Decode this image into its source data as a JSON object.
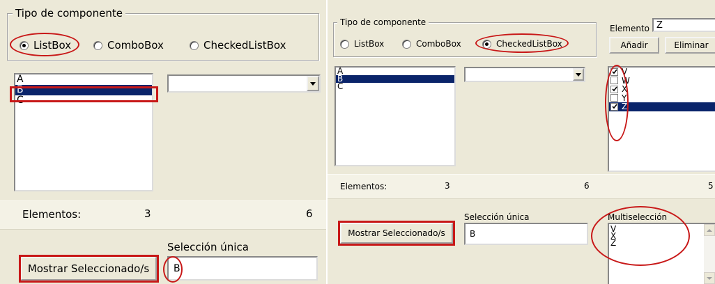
{
  "left": {
    "group_title": "Tipo de componente",
    "radios": [
      {
        "label": "ListBox",
        "checked": true
      },
      {
        "label": "ComboBox",
        "checked": false
      },
      {
        "label": "CheckedListBox",
        "checked": false
      }
    ],
    "listbox_items": [
      {
        "text": "A",
        "selected": false
      },
      {
        "text": "B",
        "selected": true
      },
      {
        "text": "C",
        "selected": false
      }
    ],
    "combo_value": "",
    "elementos_label": "Elementos:",
    "elementos_count_1": "3",
    "elementos_count_2": "6",
    "show_button": "Mostrar Seleccionado/s",
    "seleccion_label": "Selección única",
    "seleccion_value": "B"
  },
  "right": {
    "group_title": "Tipo de componente",
    "radios": [
      {
        "label": "ListBox",
        "checked": false
      },
      {
        "label": "ComboBox",
        "checked": false
      },
      {
        "label": "CheckedListBox",
        "checked": true
      }
    ],
    "elemento_label": "Elemento",
    "elemento_value": "Z",
    "add_button": "Añadir",
    "remove_button": "Eliminar",
    "listbox_items": [
      {
        "text": "A",
        "selected": false
      },
      {
        "text": "B",
        "selected": true
      },
      {
        "text": "C",
        "selected": false
      }
    ],
    "combo_value": "",
    "checked_items": [
      {
        "text": "V",
        "checked": true,
        "selected": false
      },
      {
        "text": "W",
        "checked": false,
        "selected": false
      },
      {
        "text": "X",
        "checked": true,
        "selected": false
      },
      {
        "text": "Y",
        "checked": false,
        "selected": false
      },
      {
        "text": "Z",
        "checked": true,
        "selected": true
      }
    ],
    "elementos_label": "Elementos:",
    "elementos_count_1": "3",
    "elementos_count_2": "6",
    "elementos_count_3": "5",
    "show_button": "Mostrar Seleccionado/s",
    "seleccion_label": "Selección única",
    "seleccion_value": "B",
    "multi_label": "Multiselección",
    "multi_lines": [
      "V",
      "X",
      "Z"
    ]
  },
  "colors": {
    "window_bg": "#ece9d8",
    "selection": "#0a246a",
    "annotation_red": "#c81818"
  }
}
